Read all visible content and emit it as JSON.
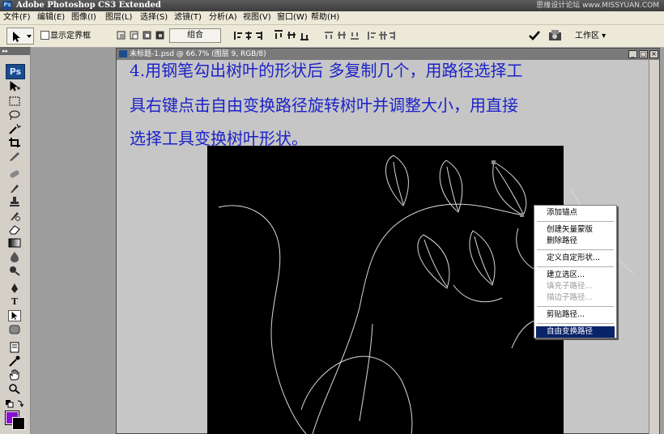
{
  "app": {
    "title": "Adobe Photoshop CS3 Extended",
    "logo": "Ps",
    "watermark": "思缘设计论坛 www.MISSYUAN.COM"
  },
  "menu": [
    "文件(F)",
    "编辑(E)",
    "图像(I)",
    "图层(L)",
    "选择(S)",
    "滤镜(T)",
    "分析(A)",
    "视图(V)",
    "窗口(W)",
    "帮助(H)"
  ],
  "options": {
    "show_bounding_box": "显示定界框",
    "combine": "组合",
    "workspace": "工作区 ▾"
  },
  "document": {
    "title": "未标题-1.psd @ 66.7% (图层 9, RGB/8)"
  },
  "instruction": [
    "4.用钢笔勾出树叶的形状后 多复制几个，用路径选择工",
    "具右键点击自由变换路径旋转树叶并调整大小，用直接",
    "选择工具变换树叶形状。"
  ],
  "context_menu": [
    {
      "label": "添加锚点",
      "state": "normal"
    },
    {
      "label": "创建矢量蒙版",
      "state": "normal"
    },
    {
      "label": "删除路径",
      "state": "normal"
    },
    {
      "label": "定义自定形状...",
      "state": "normal"
    },
    {
      "label": "建立选区...",
      "state": "normal"
    },
    {
      "label": "填充子路径...",
      "state": "disabled"
    },
    {
      "label": "描边子路径...",
      "state": "disabled"
    },
    {
      "label": "剪贴路径...",
      "state": "normal"
    },
    {
      "label": "自由变换路径",
      "state": "selected"
    }
  ],
  "colors": {
    "foreground": "#8a0fd2",
    "background": "#000000",
    "instruction_text": "#1c22c8",
    "menu_highlight": "#0a246a"
  },
  "icons": [
    "move-icon",
    "marquee-icon",
    "lasso-icon",
    "magic-wand-icon",
    "crop-icon",
    "slice-icon",
    "healing-icon",
    "brush-icon",
    "stamp-icon",
    "history-brush-icon",
    "eraser-icon",
    "gradient-icon",
    "blur-icon",
    "dodge-icon",
    "pen-icon",
    "type-icon",
    "path-select-icon",
    "shape-icon",
    "notes-icon",
    "eyedropper-icon",
    "hand-icon",
    "zoom-icon"
  ]
}
